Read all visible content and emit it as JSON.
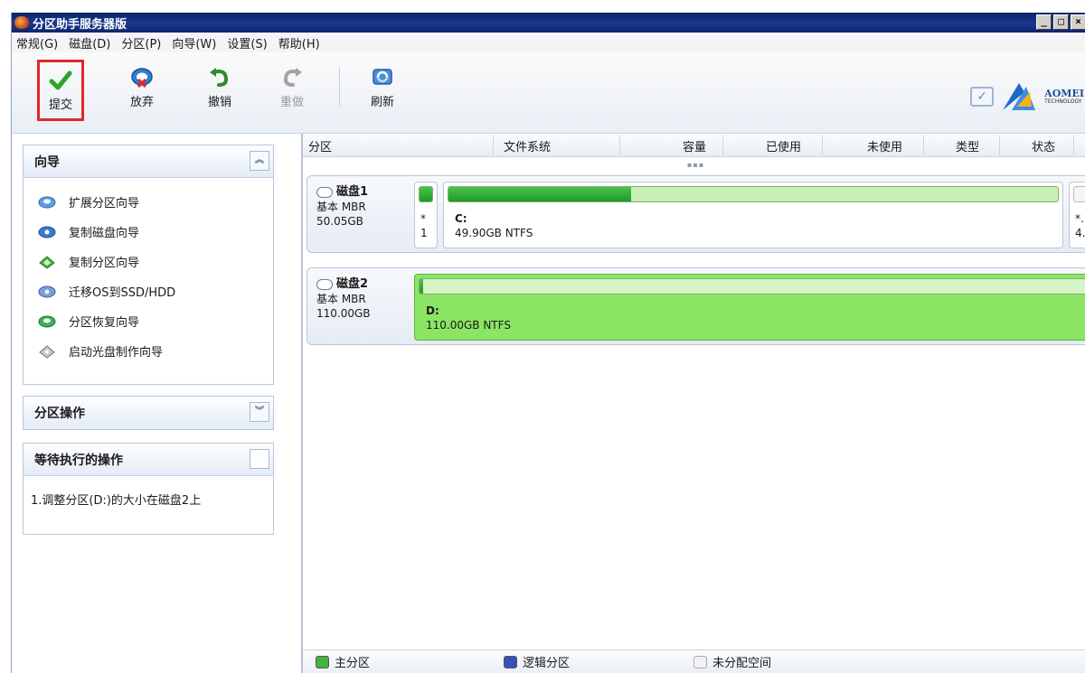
{
  "window": {
    "title": "分区助手服务器版",
    "buttons": [
      "_",
      "□",
      "×"
    ]
  },
  "menu": [
    "常规(G)",
    "磁盘(D)",
    "分区(P)",
    "向导(W)",
    "设置(S)",
    "帮助(H)"
  ],
  "toolbar": {
    "commit_label": "提交",
    "discard_label": "放弃",
    "undo_label": "撤销",
    "redo_label": "重做",
    "refresh_label": "刷新",
    "brand": "AOMEI",
    "brand_sub": "TECHNOLOGY"
  },
  "wizard_panel": {
    "title": "向导",
    "items": [
      "扩展分区向导",
      "复制磁盘向导",
      "复制分区向导",
      "迁移OS到SSD/HDD",
      "分区恢复向导",
      "启动光盘制作向导"
    ]
  },
  "partition_ops_panel": {
    "title": "分区操作"
  },
  "pending_panel": {
    "title": "等待执行的操作",
    "items": [
      "1.调整分区(D:)的大小在磁盘2上"
    ]
  },
  "columns": [
    "分区",
    "文件系统",
    "容量",
    "已使用",
    "未使用",
    "类型",
    "状态"
  ],
  "disks": [
    {
      "name": "磁盘1",
      "type": "基本 MBR",
      "size": "50.05GB",
      "small_part": {
        "mark": "*",
        "num": "1"
      },
      "partition": {
        "letter": "C:",
        "desc": "49.90GB NTFS",
        "used_fraction": 0.3
      },
      "extra_part": {
        "mark": "*.",
        "num": "4."
      }
    },
    {
      "name": "磁盘2",
      "type": "基本 MBR",
      "size": "110.00GB",
      "partition": {
        "letter": "D:",
        "desc": "110.00GB NTFS",
        "used_fraction": 0.005
      }
    }
  ],
  "legend": [
    {
      "label": "主分区",
      "color": "#3fb43f"
    },
    {
      "label": "逻辑分区",
      "color": "#3a4fb8"
    },
    {
      "label": "未分配空间",
      "color": "#f2f2f2"
    }
  ],
  "colors": {
    "title_bar": "#0a246a",
    "highlight": "#e0282c",
    "partition_green": "#8ce464"
  }
}
